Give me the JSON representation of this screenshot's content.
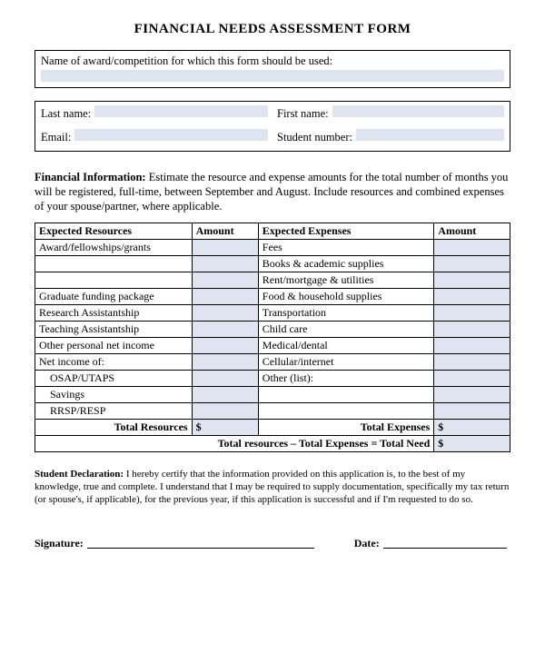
{
  "title": "FINANCIAL NEEDS ASSESSMENT FORM",
  "award_box": {
    "label": "Name of award/competition for which this form should be used:"
  },
  "personal": {
    "last_name_label": "Last name:",
    "first_name_label": "First name:",
    "email_label": "Email:",
    "student_number_label": "Student number:"
  },
  "fin_info": {
    "heading": "Financial Information:",
    "text": " Estimate the resource and expense amounts for the total number of months you will be registered, full-time, between September and August.  Include resources and combined expenses of your spouse/partner, where applicable."
  },
  "table": {
    "headers": {
      "resources": "Expected Resources",
      "amount1": "Amount",
      "expenses": "Expected Expenses",
      "amount2": "Amount"
    },
    "rows": [
      {
        "res": "Award/fellowships/grants",
        "exp": "Fees"
      },
      {
        "res": "",
        "exp": "Books & academic supplies"
      },
      {
        "res": "",
        "exp": "Rent/mortgage & utilities"
      },
      {
        "res": "Graduate funding package",
        "exp": "Food & household supplies"
      },
      {
        "res": "Research Assistantship",
        "exp": "Transportation"
      },
      {
        "res": "Teaching Assistantship",
        "exp": "Child care"
      },
      {
        "res": "Other personal net income",
        "exp": "Medical/dental"
      },
      {
        "res": "Net income of:",
        "exp": "Cellular/internet"
      },
      {
        "res": "OSAP/UTAPS",
        "indent": true,
        "exp": "Other (list):"
      },
      {
        "res": "Savings",
        "indent": true,
        "exp": ""
      },
      {
        "res": "RRSP/RESP",
        "indent": true,
        "exp": ""
      }
    ],
    "totals": {
      "resources_label": "Total Resources",
      "expenses_label": "Total Expenses",
      "need_label": "Total resources – Total Expenses = Total Need",
      "dollar": "$"
    }
  },
  "declaration": {
    "heading": "Student Declaration:",
    "text": " I hereby certify that the information provided on this application is, to the best of my knowledge, true and complete.  I understand that I may be required to supply documentation, specifically my tax return (or spouse's, if applicable), for the previous year, if this application is successful and if I'm requested to do so."
  },
  "signature": {
    "sig_label": "Signature:",
    "date_label": "Date:"
  }
}
